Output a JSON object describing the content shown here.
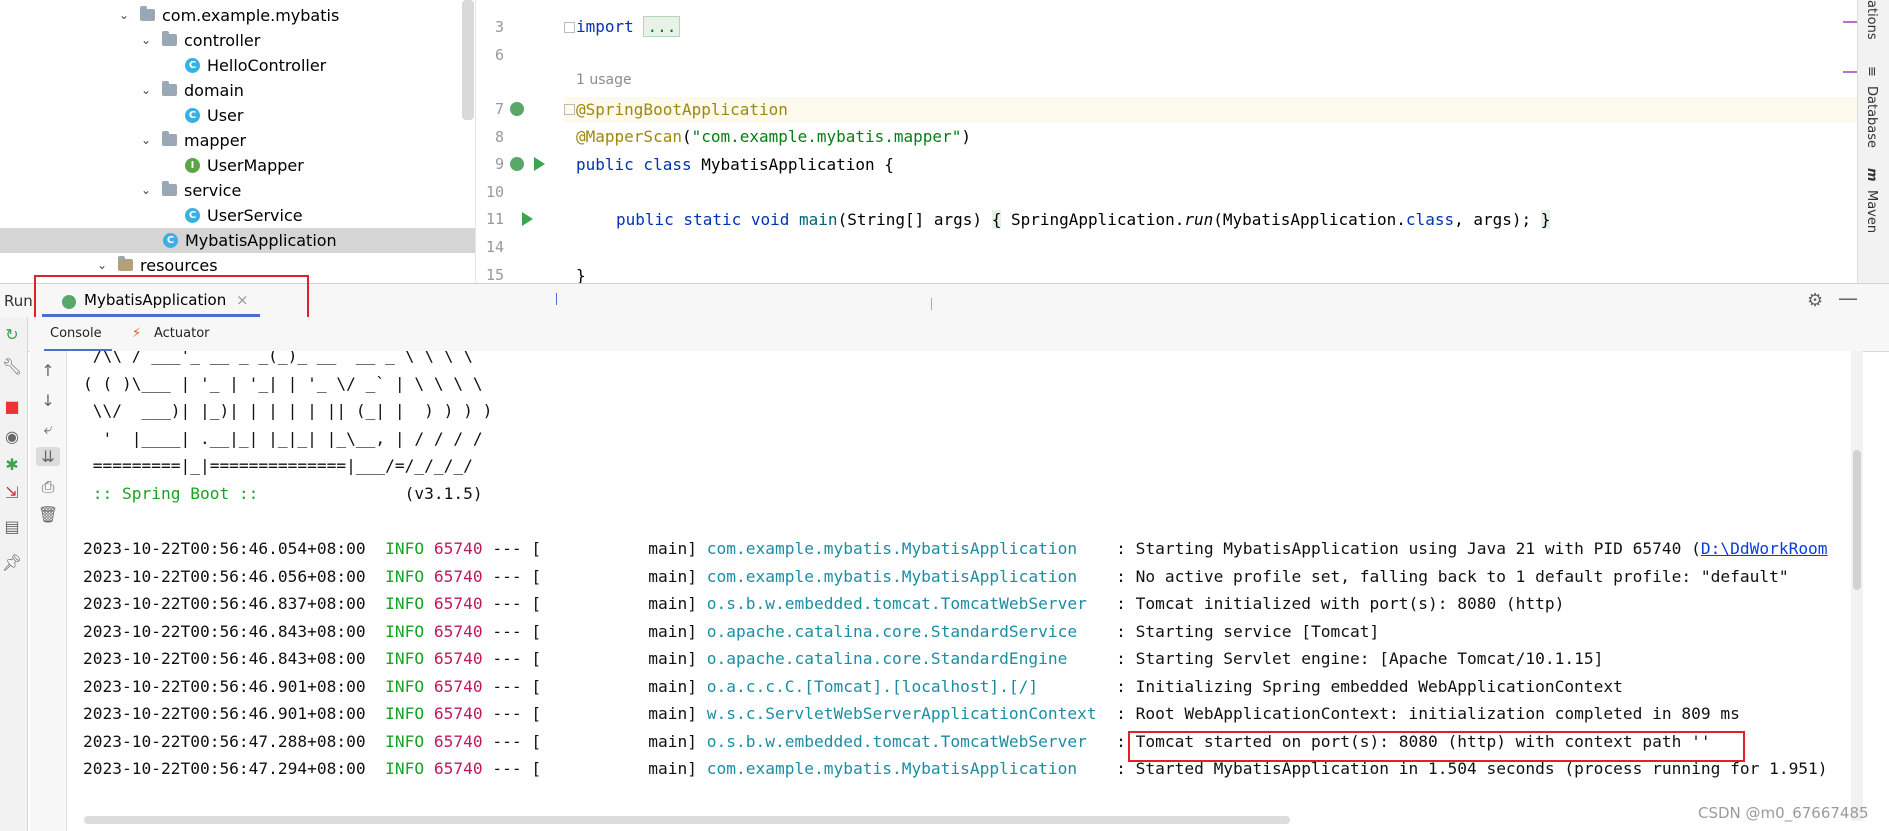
{
  "project_tree": {
    "items": [
      {
        "label": "com.example.mybatis",
        "kind": "package"
      },
      {
        "label": "controller",
        "kind": "package"
      },
      {
        "label": "HelloController",
        "kind": "class"
      },
      {
        "label": "domain",
        "kind": "package"
      },
      {
        "label": "User",
        "kind": "class"
      },
      {
        "label": "mapper",
        "kind": "package"
      },
      {
        "label": "UserMapper",
        "kind": "interface"
      },
      {
        "label": "service",
        "kind": "package"
      },
      {
        "label": "UserService",
        "kind": "class"
      },
      {
        "label": "MybatisApplication",
        "kind": "class",
        "selected": true
      },
      {
        "label": "resources",
        "kind": "folder"
      }
    ]
  },
  "editor": {
    "line_numbers": [
      "3",
      "6",
      "7",
      "8",
      "9",
      "10",
      "11",
      "14",
      "15"
    ],
    "usage_hint": "1 usage",
    "code": {
      "import_kw": "import",
      "import_fold": "...",
      "annotation1": "@SpringBootApplication",
      "annotation2": "@MapperScan",
      "annotation2_open": "(",
      "annotation2_arg": "\"com.example.mybatis.mapper\"",
      "annotation2_close": ")",
      "class_decl_kw": "public class",
      "class_decl_rest": " MybatisApplication {",
      "main_kw": "public static void",
      "main_name": " main",
      "main_params": "(String[] args) ",
      "main_open": "{",
      "main_body1": " SpringApplication.",
      "main_run": "run",
      "main_body2": "(MybatisApplication.",
      "main_class_kw": "class",
      "main_body3": ", args); ",
      "main_close": "}",
      "closing_brace": "}"
    },
    "right_tabs": [
      "ations",
      "Database",
      "Maven"
    ]
  },
  "run_panel": {
    "label": "Run",
    "tab_title": "MybatisApplication",
    "tab_close": "×",
    "subtabs": [
      "Console",
      "Actuator"
    ],
    "banner": [
      " /\\\\ / ___'_ __ _ _(_)_ __  __ _ \\ \\ \\ \\",
      "( ( )\\___ | '_ | '_| | '_ \\/ _` | \\ \\ \\ \\",
      " \\\\/  ___)| |_)| | | | | || (_| |  ) ) ) )",
      "  '  |____| .__|_| |_|_| |_\\__, | / / / /",
      " =========|_|==============|___/=/_/_/_/"
    ],
    "spring_boot_label": " :: Spring Boot :: ",
    "spring_boot_version": "              (v3.1.5)",
    "log_lines": [
      {
        "ts": "2023-10-22T00:56:46.054+08:00",
        "level": "INFO",
        "pid": "65740",
        "thread": "--- [           main]",
        "logger": "com.example.mybatis.MybatisApplication   ",
        "msg": ": Starting MybatisApplication using Java 21 with PID 65740 (",
        "link": "D:\\DdWorkRoom"
      },
      {
        "ts": "2023-10-22T00:56:46.056+08:00",
        "level": "INFO",
        "pid": "65740",
        "thread": "--- [           main]",
        "logger": "com.example.mybatis.MybatisApplication   ",
        "msg": ": No active profile set, falling back to 1 default profile: \"default\""
      },
      {
        "ts": "2023-10-22T00:56:46.837+08:00",
        "level": "INFO",
        "pid": "65740",
        "thread": "--- [           main]",
        "logger": "o.s.b.w.embedded.tomcat.TomcatWebServer  ",
        "msg": ": Tomcat initialized with port(s): 8080 (http)"
      },
      {
        "ts": "2023-10-22T00:56:46.843+08:00",
        "level": "INFO",
        "pid": "65740",
        "thread": "--- [           main]",
        "logger": "o.apache.catalina.core.StandardService   ",
        "msg": ": Starting service [Tomcat]"
      },
      {
        "ts": "2023-10-22T00:56:46.843+08:00",
        "level": "INFO",
        "pid": "65740",
        "thread": "--- [           main]",
        "logger": "o.apache.catalina.core.StandardEngine    ",
        "msg": ": Starting Servlet engine: [Apache Tomcat/10.1.15]"
      },
      {
        "ts": "2023-10-22T00:56:46.901+08:00",
        "level": "INFO",
        "pid": "65740",
        "thread": "--- [           main]",
        "logger": "o.a.c.c.C.[Tomcat].[localhost].[/]       ",
        "msg": ": Initializing Spring embedded WebApplicationContext"
      },
      {
        "ts": "2023-10-22T00:56:46.901+08:00",
        "level": "INFO",
        "pid": "65740",
        "thread": "--- [           main]",
        "logger": "w.s.c.ServletWebServerApplicationContext ",
        "msg": ": Root WebApplicationContext: initialization completed in 809 ms"
      },
      {
        "ts": "2023-10-22T00:56:47.288+08:00",
        "level": "INFO",
        "pid": "65740",
        "thread": "--- [           main]",
        "logger": "o.s.b.w.embedded.tomcat.TomcatWebServer  ",
        "msg": ": Tomcat started on port(s): 8080 (http) with context path ''"
      },
      {
        "ts": "2023-10-22T00:56:47.294+08:00",
        "level": "INFO",
        "pid": "65740",
        "thread": "--- [           main]",
        "logger": "com.example.mybatis.MybatisApplication   ",
        "msg": ": Started MybatisApplication in 1.504 seconds (process running for 1.951)"
      }
    ]
  },
  "watermark": "CSDN @m0_67667485",
  "colors": {
    "info": "#17a325",
    "pid": "#c2185b",
    "logger": "#1b8ea3",
    "highlight_box": "#e0202a",
    "keyword": "#0033b3",
    "annotation": "#9e880d",
    "string": "#067d17"
  }
}
